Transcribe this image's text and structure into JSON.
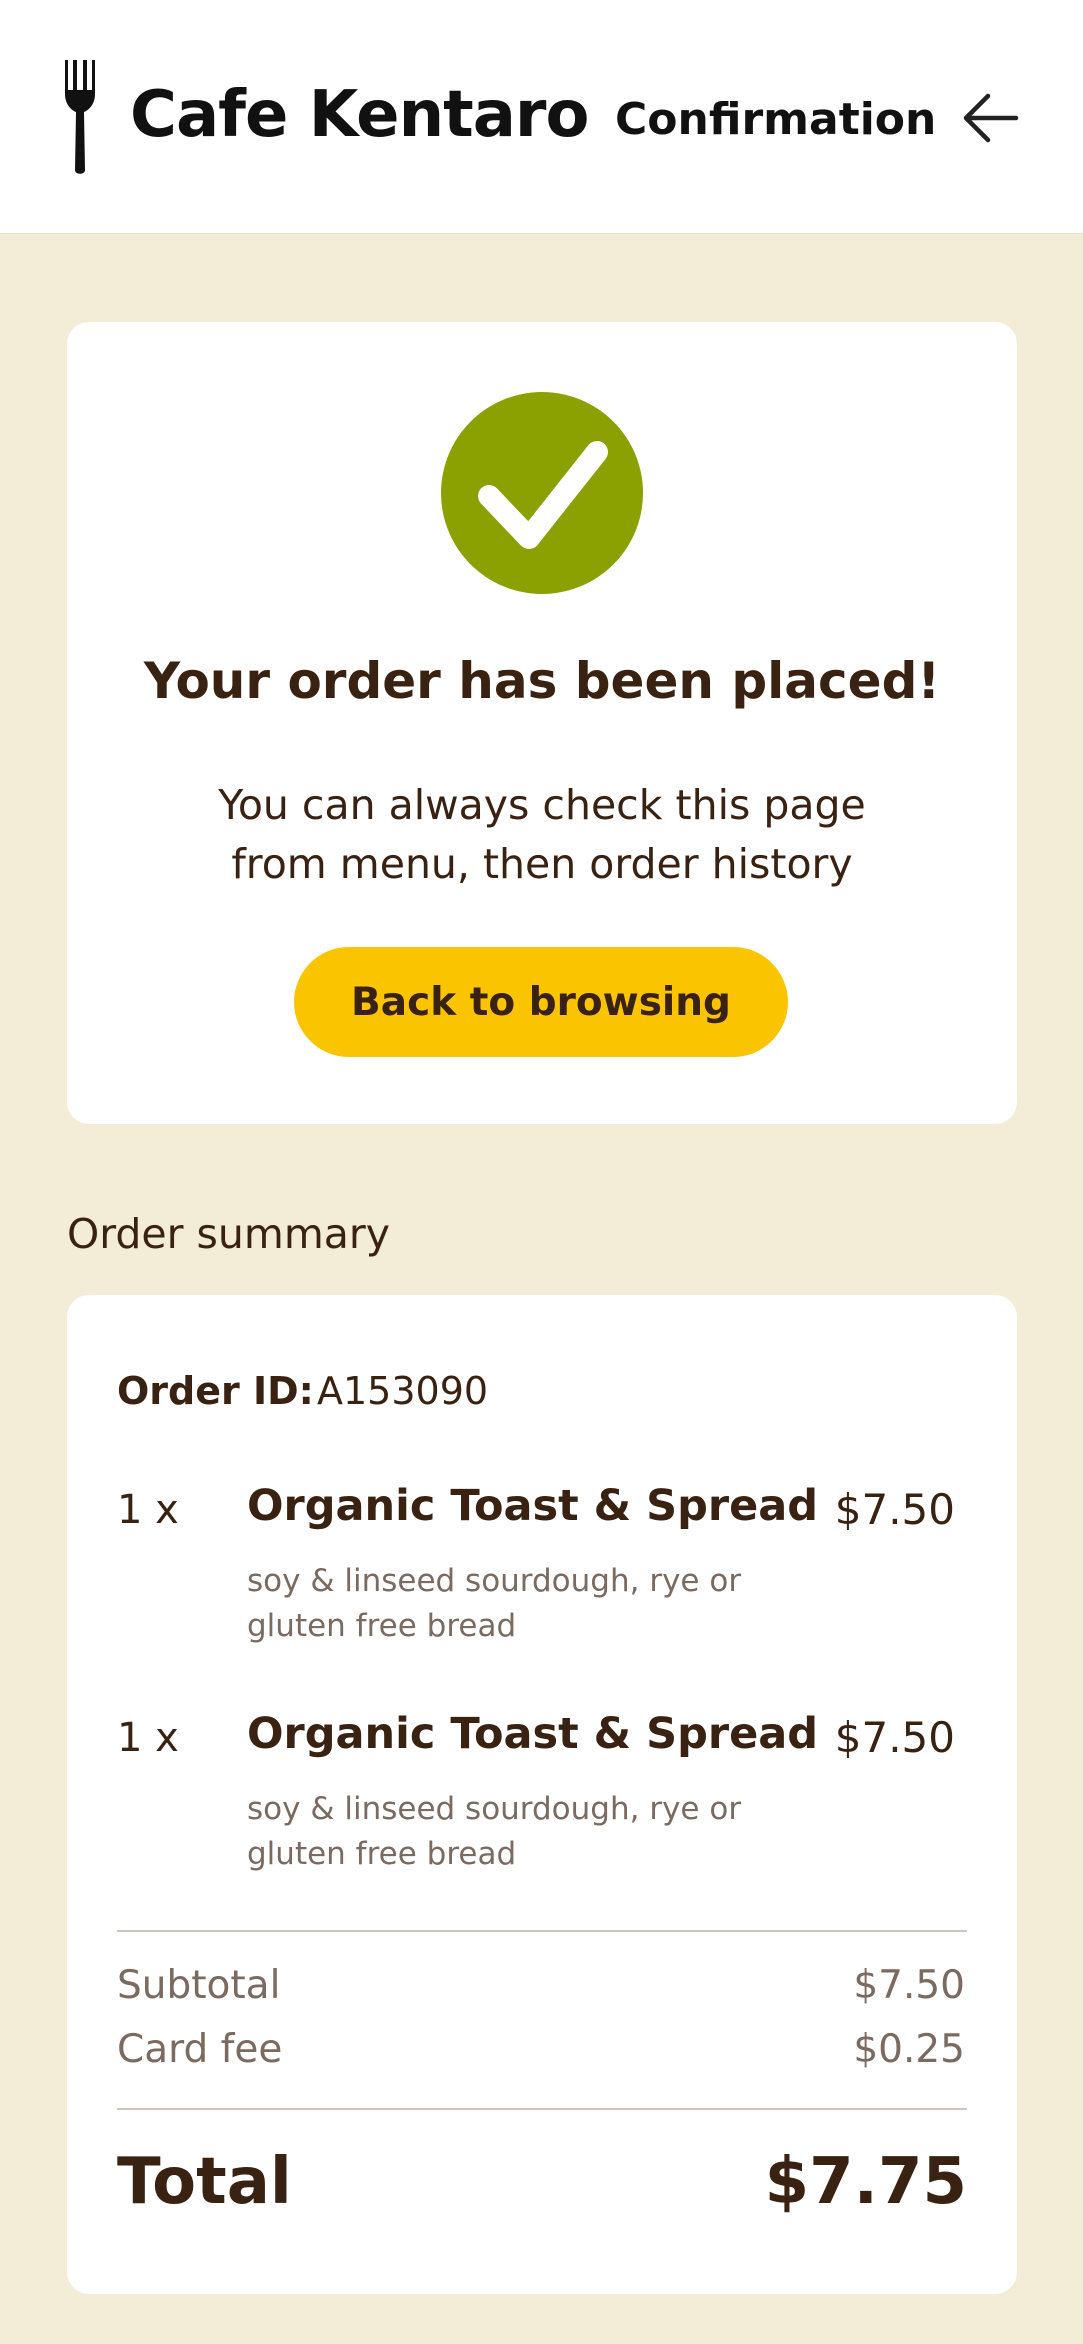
{
  "header": {
    "brand": "Cafe Kentaro",
    "page_title": "Confirmation",
    "back_icon": "arrow-left-icon",
    "logo_icon": "fork-icon"
  },
  "confirmation": {
    "icon": "checkmark-icon",
    "title": "Your order has been placed!",
    "message": "You can always check this page from menu, then order history",
    "button_label": "Back to browsing"
  },
  "summary": {
    "heading": "Order summary",
    "order_id_label": "Order ID:",
    "order_id": "A153090",
    "items": [
      {
        "qty": "1 x",
        "name": "Organic Toast & Spread",
        "description": "soy & linseed sourdough, rye or gluten free bread",
        "price": "$7.50"
      },
      {
        "qty": "1 x",
        "name": "Organic Toast & Spread",
        "description": "soy & linseed sourdough, rye or gluten free bread",
        "price": "$7.50"
      }
    ],
    "subtotal_label": "Subtotal",
    "subtotal": "$7.50",
    "card_fee_label": "Card fee",
    "card_fee": "$0.25",
    "total_label": "Total",
    "total": "$7.75"
  },
  "colors": {
    "background": "#f3ecd6",
    "accent_green": "#8ba101",
    "button_yellow": "#fac400",
    "text_brown": "#3a2212"
  }
}
